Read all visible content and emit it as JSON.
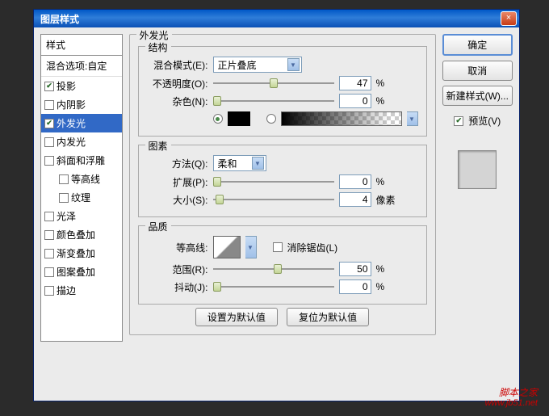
{
  "titlebar": {
    "title": "图层样式",
    "close": "×"
  },
  "left": {
    "header": "样式",
    "blendOpts": "混合选项:自定",
    "items": [
      {
        "label": "投影",
        "checked": true
      },
      {
        "label": "内阴影",
        "checked": false
      },
      {
        "label": "外发光",
        "checked": true,
        "selected": true
      },
      {
        "label": "内发光",
        "checked": false
      },
      {
        "label": "斜面和浮雕",
        "checked": false
      },
      {
        "label": "等高线",
        "checked": false,
        "sub": true
      },
      {
        "label": "纹理",
        "checked": false,
        "sub": true
      },
      {
        "label": "光泽",
        "checked": false
      },
      {
        "label": "颜色叠加",
        "checked": false
      },
      {
        "label": "渐变叠加",
        "checked": false
      },
      {
        "label": "图案叠加",
        "checked": false
      },
      {
        "label": "描边",
        "checked": false
      }
    ]
  },
  "main": {
    "title": "外发光",
    "struct": {
      "title": "结构",
      "blendMode": {
        "label": "混合模式(E):",
        "value": "正片叠底"
      },
      "opacity": {
        "label": "不透明度(O):",
        "value": "47",
        "unit": "%",
        "thumb": 47
      },
      "noise": {
        "label": "杂色(N):",
        "value": "0",
        "unit": "%",
        "thumb": 0
      },
      "solidColor": "#000000"
    },
    "elem": {
      "title": "图素",
      "technique": {
        "label": "方法(Q):",
        "value": "柔和"
      },
      "spread": {
        "label": "扩展(P):",
        "value": "0",
        "unit": "%",
        "thumb": 0
      },
      "size": {
        "label": "大小(S):",
        "value": "4",
        "unit": "像素",
        "thumb": 3
      }
    },
    "quality": {
      "title": "品质",
      "contour": {
        "label": "等高线:"
      },
      "antialias": {
        "label": "消除锯齿(L)",
        "checked": false
      },
      "range": {
        "label": "范围(R):",
        "value": "50",
        "unit": "%",
        "thumb": 50
      },
      "jitter": {
        "label": "抖动(J):",
        "value": "0",
        "unit": "%",
        "thumb": 0
      }
    },
    "setDefault": "设置为默认值",
    "resetDefault": "复位为默认值"
  },
  "right": {
    "ok": "确定",
    "cancel": "取消",
    "newStyle": "新建样式(W)...",
    "preview": {
      "label": "预览(V)",
      "checked": true
    }
  },
  "watermark": {
    "main": "脚本之家",
    "sub": "www.jb51.net"
  }
}
